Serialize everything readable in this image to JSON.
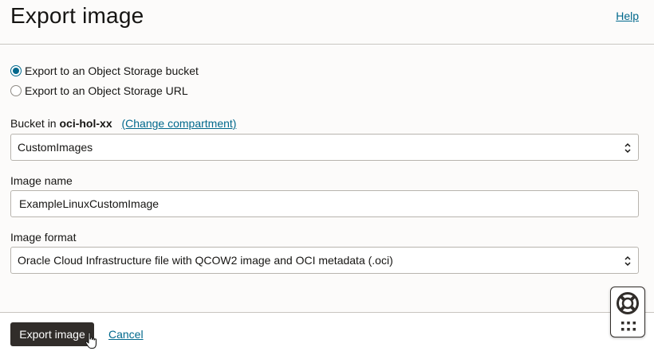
{
  "header": {
    "title": "Export image",
    "help_label": "Help"
  },
  "export_options": [
    {
      "label": "Export to an Object Storage bucket",
      "selected": true
    },
    {
      "label": "Export to an Object Storage URL",
      "selected": false
    }
  ],
  "bucket": {
    "label_prefix": "Bucket in",
    "compartment": "oci-hol-xx",
    "change_link": "(Change compartment)",
    "value": "CustomImages"
  },
  "image_name": {
    "label": "Image name",
    "value": "ExampleLinuxCustomImage"
  },
  "image_format": {
    "label": "Image format",
    "value": "Oracle Cloud Infrastructure file with QCOW2 image and OCI metadata (.oci)"
  },
  "footer": {
    "primary_label": "Export image",
    "cancel_label": "Cancel"
  },
  "icons": {
    "select_chevron": "chevron-up-down-icon",
    "help_widget": "lifebuoy-icon",
    "apps": "grid-dots-icon",
    "cursor": "hand-pointer-cursor-icon"
  },
  "colors": {
    "link": "#00688c",
    "primary_button": "#312d2a",
    "radio_selected": "#00688c"
  }
}
